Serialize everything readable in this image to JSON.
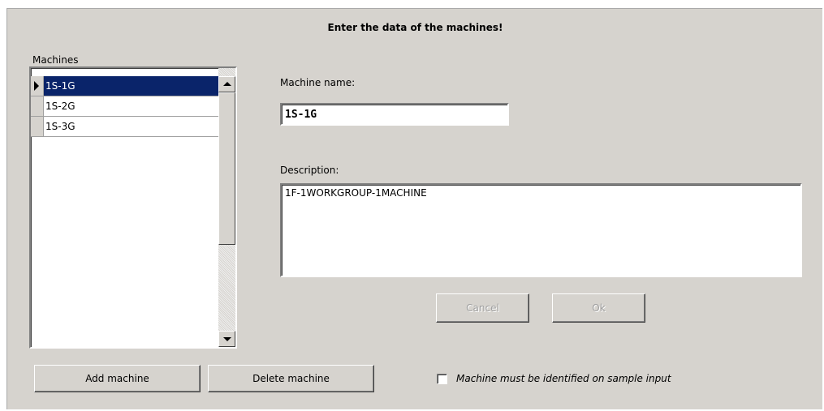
{
  "header": {
    "title": "Enter the data of the machines!"
  },
  "machines": {
    "label": "Machines",
    "rows": [
      {
        "name": "1S-1G",
        "selected": true
      },
      {
        "name": "1S-2G",
        "selected": false
      },
      {
        "name": "1S-3G",
        "selected": false
      }
    ]
  },
  "form": {
    "name_label": "Machine name:",
    "name_value": "1S-1G",
    "description_label": "Description:",
    "description_value": "1F-1WORKGROUP-1MACHINE",
    "cancel_label": "Cancel",
    "ok_label": "Ok"
  },
  "footer": {
    "add_label": "Add machine",
    "delete_label": "Delete machine",
    "checkbox_label": "Machine must be identified on sample input",
    "checkbox_checked": false
  },
  "colors": {
    "background": "#d6d3ce",
    "selection": "#0a246a",
    "disabled_text": "#a0a0a0"
  }
}
